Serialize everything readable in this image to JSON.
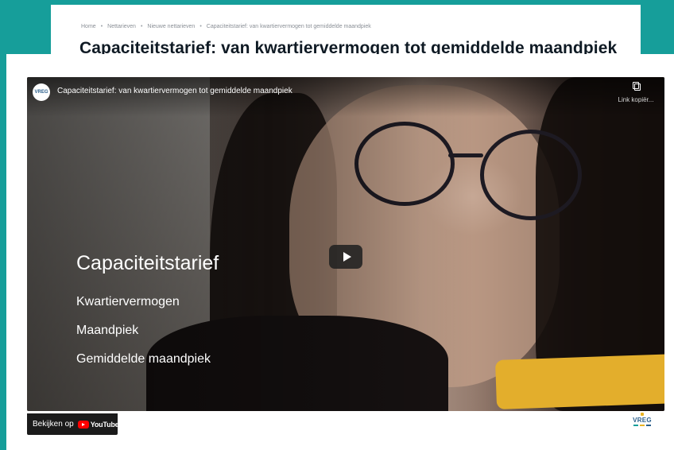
{
  "breadcrumb": {
    "items": [
      "Home",
      "Nettarieven",
      "Nieuwe nettarieven",
      "Capaciteitstarief: van kwartiervermogen tot gemiddelde maandpiek"
    ],
    "separator": "•"
  },
  "page": {
    "title": "Capaciteitstarief: van kwartiervermogen tot gemiddelde maandpiek"
  },
  "video": {
    "title": "Capaciteitstarief: van kwartiervermogen tot gemiddelde maandpiek",
    "channel_avatar_text": "VREG",
    "copy_link_label": "Link kopiër...",
    "overlay_heading": "Capaciteitstarief",
    "overlay_items": [
      "Kwartiervermogen",
      "Maandpiek",
      "Gemiddelde maandpiek"
    ],
    "watch_on_label": "Bekijken op",
    "youtube_wordmark": "YouTube",
    "watermark_text": "VREG"
  },
  "colors": {
    "background_teal": "#169e9a",
    "title_text": "#0f1a24",
    "youtube_red": "#ff0000",
    "phone_yellow": "#e3ae2c"
  },
  "icons": [
    "copy-link-icon",
    "play-icon",
    "youtube-icon"
  ]
}
